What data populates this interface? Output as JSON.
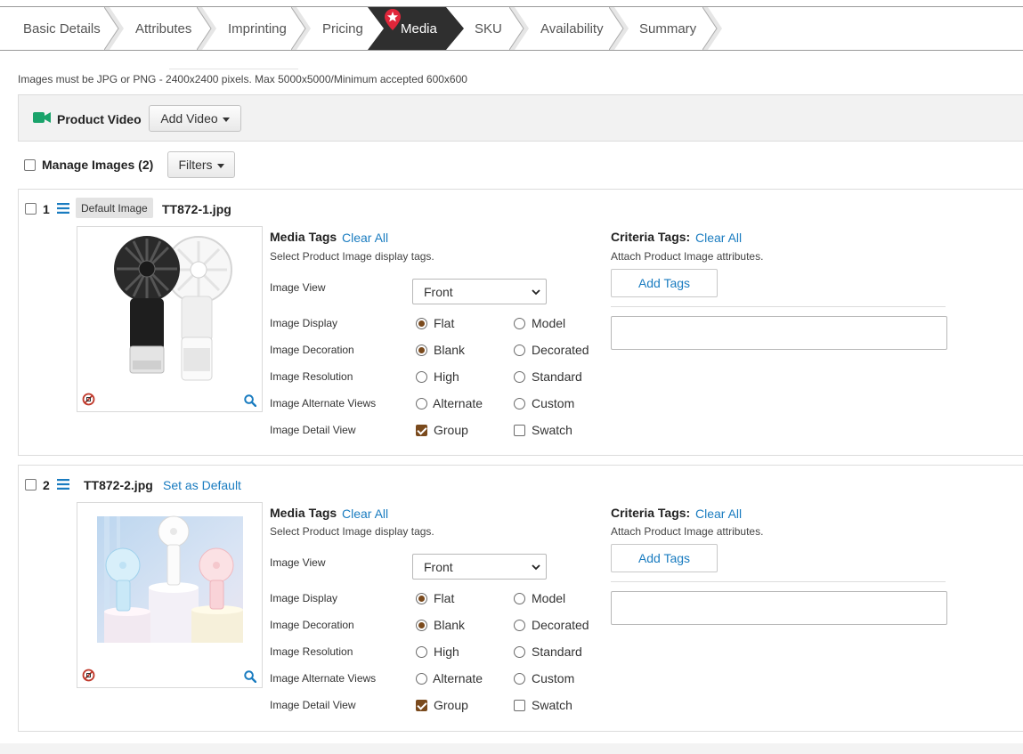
{
  "tabs": [
    {
      "label": "Basic Details"
    },
    {
      "label": "Attributes"
    },
    {
      "label": "Imprinting"
    },
    {
      "label": "Pricing"
    },
    {
      "label": "Media",
      "active": true
    },
    {
      "label": "SKU"
    },
    {
      "label": "Availability"
    },
    {
      "label": "Summary"
    }
  ],
  "notice": "Images must be JPG or PNG - 2400x2400 pixels. Max 5000x5000/Minimum accepted 600x600",
  "video": {
    "label": "Product Video",
    "add_button": "Add Video",
    "icon": "video-camera-icon"
  },
  "manage": {
    "label": "Manage Images (2)",
    "filters_button": "Filters"
  },
  "images": [
    {
      "number": "1",
      "badge": "Default Image",
      "filename": "TT872-1.jpg",
      "set_default": "",
      "media_tags_title": "Media Tags",
      "media_clear": "Clear All",
      "media_sub": "Select Product Image display tags.",
      "criteria_title": "Criteria Tags:",
      "criteria_clear": "Clear All",
      "criteria_sub": "Attach Product Image attributes.",
      "add_tags": "Add Tags",
      "view_label": "Image View",
      "view_value": "Front",
      "rows": [
        {
          "label": "Image Display",
          "a": "Flat",
          "b": "Model",
          "a_checked": true,
          "b_checked": false,
          "type": "radio"
        },
        {
          "label": "Image Decoration",
          "a": "Blank",
          "b": "Decorated",
          "a_checked": true,
          "b_checked": false,
          "type": "radio"
        },
        {
          "label": "Image Resolution",
          "a": "High",
          "b": "Standard",
          "a_checked": false,
          "b_checked": false,
          "type": "radio"
        },
        {
          "label": "Image Alternate Views",
          "a": "Alternate",
          "b": "Custom",
          "a_checked": false,
          "b_checked": false,
          "type": "radio"
        },
        {
          "label": "Image Detail View",
          "a": "Group",
          "b": "Swatch",
          "a_checked": true,
          "b_checked": false,
          "type": "checkbox"
        }
      ]
    },
    {
      "number": "2",
      "badge": "",
      "filename": "TT872-2.jpg",
      "set_default": "Set as Default",
      "media_tags_title": "Media Tags",
      "media_clear": "Clear All",
      "media_sub": "Select Product Image display tags.",
      "criteria_title": "Criteria Tags:",
      "criteria_clear": "Clear All",
      "criteria_sub": "Attach Product Image attributes.",
      "add_tags": "Add Tags",
      "view_label": "Image View",
      "view_value": "Front",
      "rows": [
        {
          "label": "Image Display",
          "a": "Flat",
          "b": "Model",
          "a_checked": true,
          "b_checked": false,
          "type": "radio"
        },
        {
          "label": "Image Decoration",
          "a": "Blank",
          "b": "Decorated",
          "a_checked": true,
          "b_checked": false,
          "type": "radio"
        },
        {
          "label": "Image Resolution",
          "a": "High",
          "b": "Standard",
          "a_checked": false,
          "b_checked": false,
          "type": "radio"
        },
        {
          "label": "Image Alternate Views",
          "a": "Alternate",
          "b": "Custom",
          "a_checked": false,
          "b_checked": false,
          "type": "radio"
        },
        {
          "label": "Image Detail View",
          "a": "Group",
          "b": "Swatch",
          "a_checked": true,
          "b_checked": false,
          "type": "checkbox"
        }
      ]
    }
  ],
  "colors": {
    "accent_link": "#1a7cc0",
    "active_tab": "#2f2f2f",
    "video_icon": "#1aa36b",
    "checked": "#7a4a1d"
  }
}
